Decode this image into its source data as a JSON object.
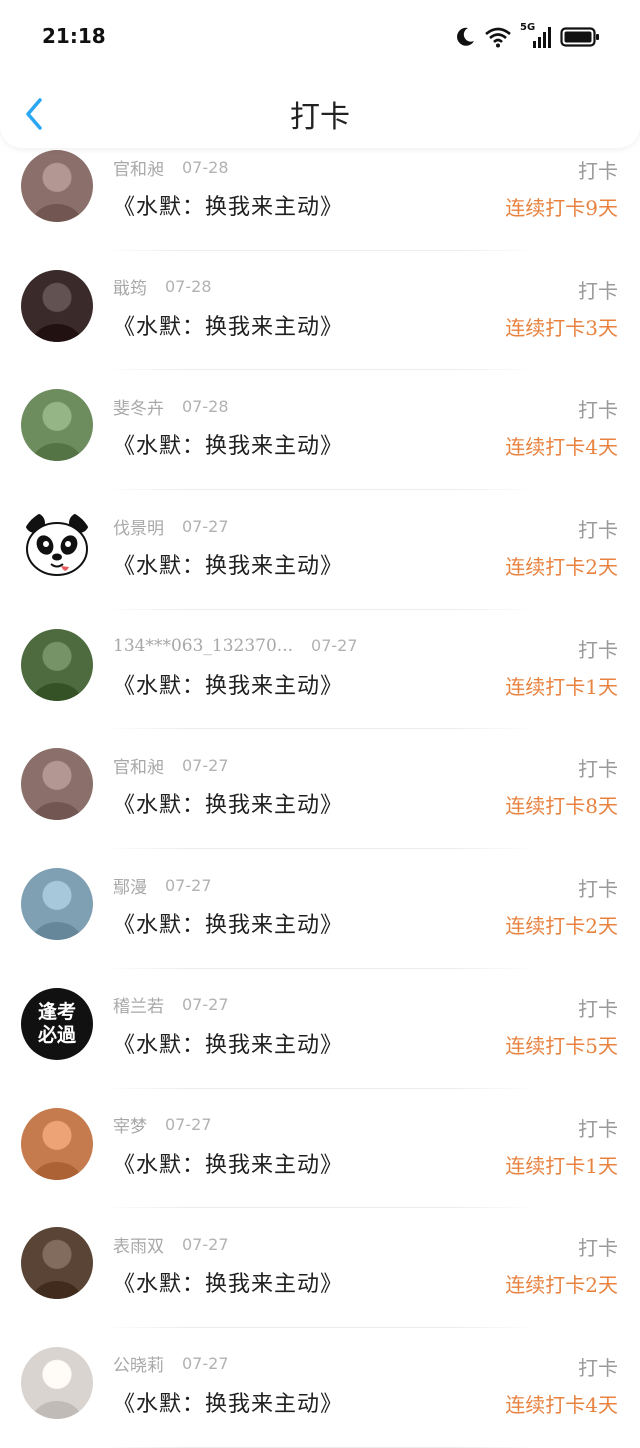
{
  "status_bar": {
    "time": "21:18",
    "network": "5G"
  },
  "navbar": {
    "title": "打卡"
  },
  "items": [
    {
      "name": "官和昶",
      "date": "07-28",
      "title": "《水默：换我来主动》",
      "kind": "打卡",
      "streak": "连续打卡9天",
      "avatar_color": "#8b6f6a",
      "avatar_icon": "avatar-photo"
    },
    {
      "name": "戢筠",
      "date": "07-28",
      "title": "《水默：换我来主动》",
      "kind": "打卡",
      "streak": "连续打卡3天",
      "avatar_color": "#3b2a2a",
      "avatar_icon": "avatar-photo"
    },
    {
      "name": "斐冬卉",
      "date": "07-28",
      "title": "《水默：换我来主动》",
      "kind": "打卡",
      "streak": "连续打卡4天",
      "avatar_color": "#6d8d5e",
      "avatar_icon": "avatar-photo"
    },
    {
      "name": "伐景明",
      "date": "07-27",
      "title": "《水默：换我来主动》",
      "kind": "打卡",
      "streak": "连续打卡2天",
      "avatar_color": "#ffffff",
      "avatar_icon": "panda"
    },
    {
      "name": "134***063_132370...",
      "date": "07-27",
      "title": "《水默：换我来主动》",
      "kind": "打卡",
      "streak": "连续打卡1天",
      "avatar_color": "#4d6b3f",
      "avatar_icon": "avatar-photo"
    },
    {
      "name": "官和昶",
      "date": "07-27",
      "title": "《水默：换我来主动》",
      "kind": "打卡",
      "streak": "连续打卡8天",
      "avatar_color": "#8b6f6a",
      "avatar_icon": "avatar-photo"
    },
    {
      "name": "鄢漫",
      "date": "07-27",
      "title": "《水默：换我来主动》",
      "kind": "打卡",
      "streak": "连续打卡2天",
      "avatar_color": "#7f9fb3",
      "avatar_icon": "avatar-photo"
    },
    {
      "name": "稽兰若",
      "date": "07-27",
      "title": "《水默：换我来主动》",
      "kind": "打卡",
      "streak": "连续打卡5天",
      "avatar_color": "#111111",
      "avatar_icon": "badge"
    },
    {
      "name": "宰梦",
      "date": "07-27",
      "title": "《水默：换我来主动》",
      "kind": "打卡",
      "streak": "连续打卡1天",
      "avatar_color": "#c57b4e",
      "avatar_icon": "avatar-photo"
    },
    {
      "name": "表雨双",
      "date": "07-27",
      "title": "《水默：换我来主动》",
      "kind": "打卡",
      "streak": "连续打卡2天",
      "avatar_color": "#5a4436",
      "avatar_icon": "avatar-photo"
    },
    {
      "name": "公晓莉",
      "date": "07-27",
      "title": "《水默：换我来主动》",
      "kind": "打卡",
      "streak": "连续打卡4天",
      "avatar_color": "#d9d4cf",
      "avatar_icon": "avatar-photo"
    }
  ],
  "badge_text": {
    "line1": "逢考",
    "line2": "必過"
  }
}
